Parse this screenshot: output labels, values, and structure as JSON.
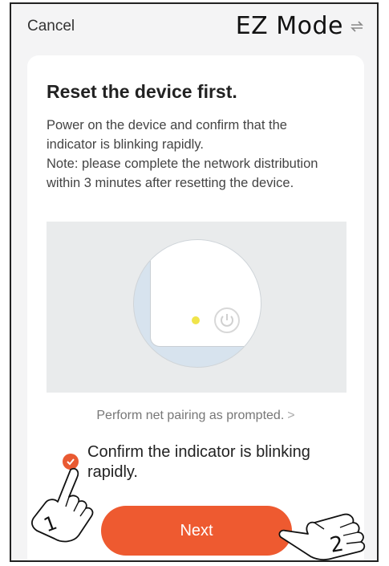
{
  "header": {
    "cancel_label": "Cancel",
    "mode_label": "EZ Mode",
    "switch_icon": "swap-arrows-icon"
  },
  "card": {
    "title": "Reset the device first.",
    "description": [
      "Power on the device and confirm that the indicator is blinking rapidly.",
      "Note: please complete the network distribution within 3 minutes after resetting the device."
    ],
    "illustration": {
      "indicator_icon": "led-indicator-icon",
      "power_icon": "power-button-icon",
      "led_color": "#f0e44a"
    },
    "pairing_link": "Perform net pairing as prompted.",
    "pairing_chevron": ">",
    "confirm_checked": true,
    "confirm_text": "Confirm the indicator is blinking rapidly.",
    "next_label": "Next"
  },
  "annotations": {
    "step1_label": "1",
    "step2_label": "2"
  },
  "colors": {
    "accent": "#ee5a30",
    "checkbox": "#e95a32",
    "background": "#f4f4f5"
  }
}
